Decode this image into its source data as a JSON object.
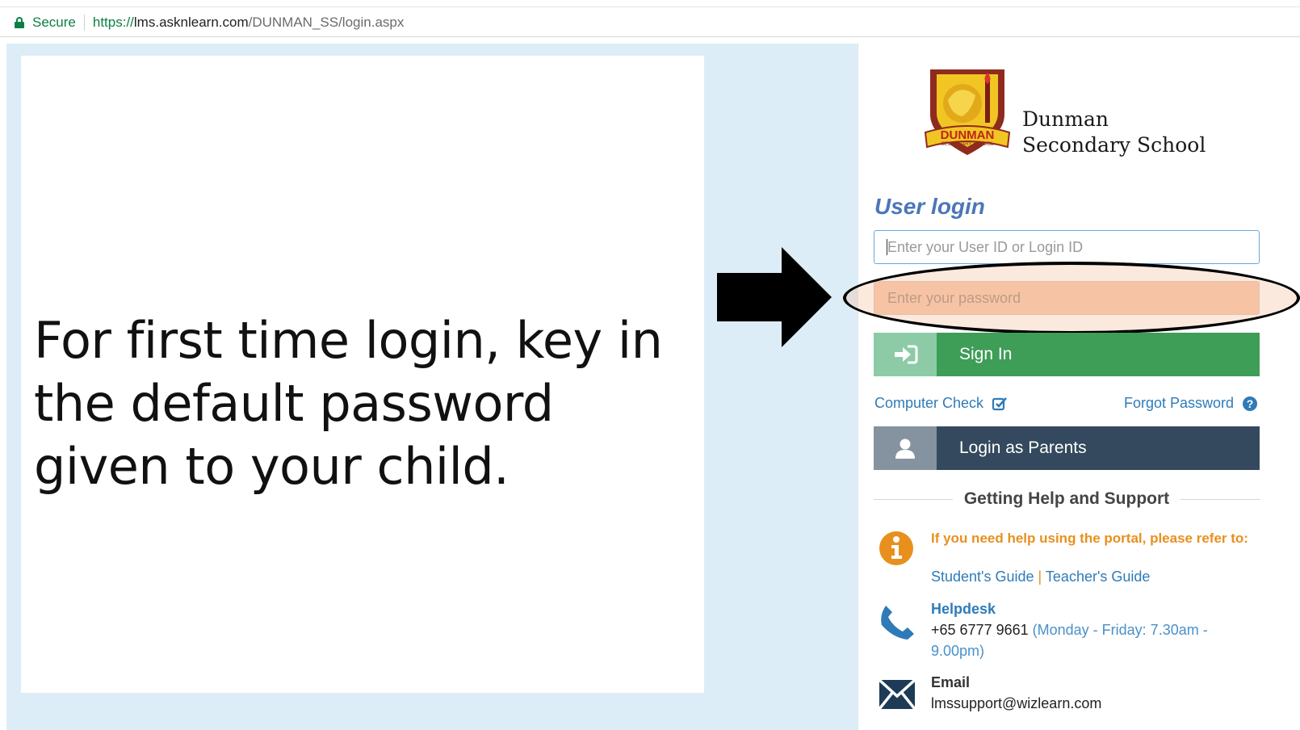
{
  "browser": {
    "secure_label": "Secure",
    "url_scheme": "https://",
    "url_host": "lms.asknlearn.com",
    "url_path": "/DUNMAN_SS/login.aspx"
  },
  "slide": {
    "instruction": "For first time login, key in the default password given to your child."
  },
  "school": {
    "logo_text": "DUNMAN",
    "logo_subtext": "SECONDARY SCHOOL",
    "name_line1": "Dunman",
    "name_line2": "Secondary School"
  },
  "login": {
    "title": "User login",
    "userid_placeholder": "Enter your User ID or Login ID",
    "password_placeholder": "Enter your password",
    "signin_label": "Sign In",
    "computer_check": "Computer Check",
    "forgot_password": "Forgot Password",
    "parents_label": "Login as Parents"
  },
  "help": {
    "heading": "Getting Help and Support",
    "info_text": "If you need help using the portal, please refer to:",
    "student_guide": "Student's Guide",
    "guide_separator": "|",
    "teacher_guide": "Teacher's Guide",
    "helpdesk_label": "Helpdesk",
    "helpdesk_phone": "+65 6777 9661",
    "helpdesk_hours": "(Monday - Friday: 7.30am - 9.00pm)",
    "email_label": "Email",
    "email_address": "lmssupport@wizlearn.com"
  },
  "colors": {
    "accent_blue": "#4b77b8",
    "signin_green": "#3e9d57",
    "parents_navy": "#34495e",
    "help_orange": "#e8901e",
    "password_highlight": "#f6c7a8"
  }
}
